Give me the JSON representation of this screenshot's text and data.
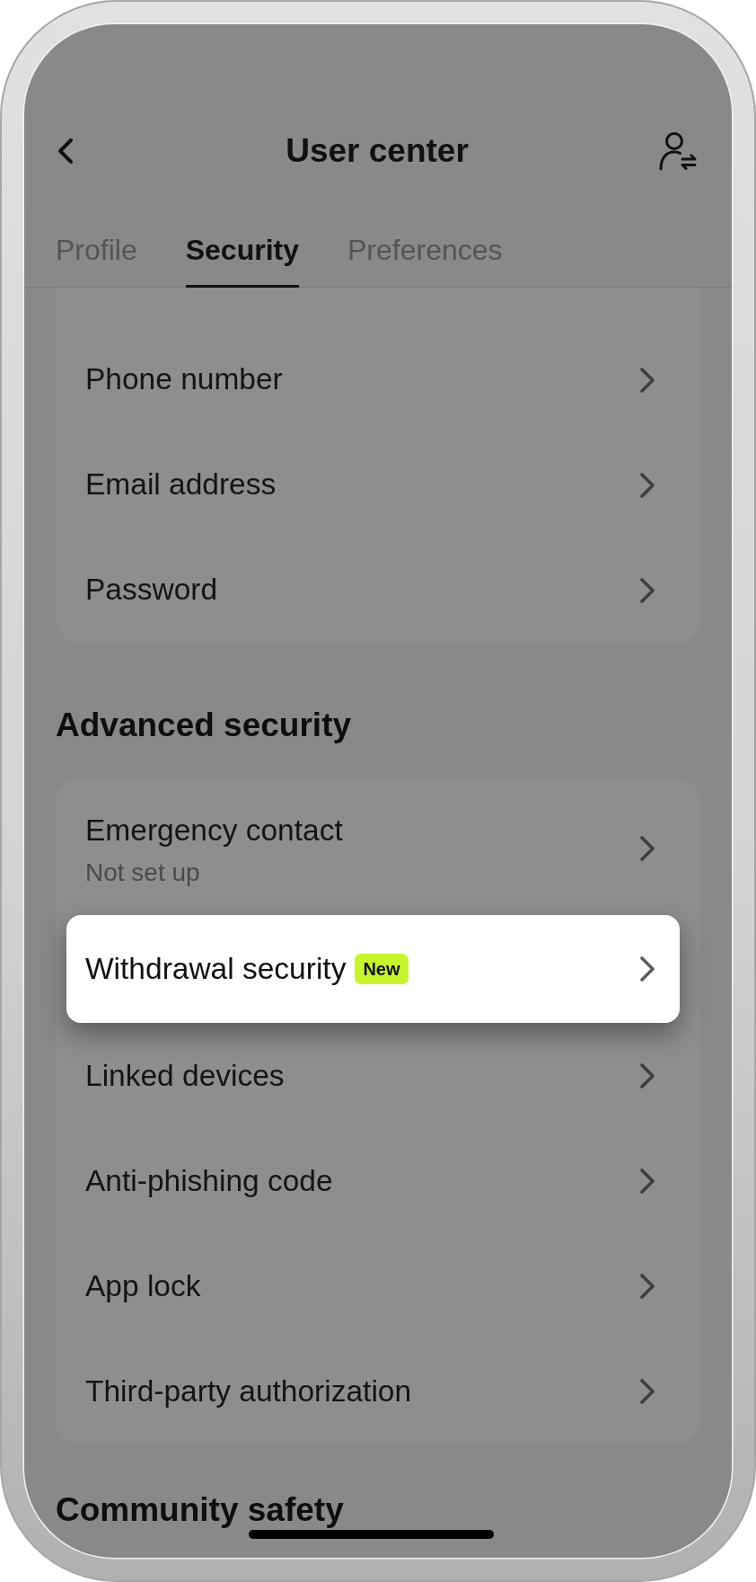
{
  "header": {
    "title": "User center"
  },
  "tabs": [
    {
      "label": "Profile",
      "selected": false
    },
    {
      "label": "Security",
      "selected": true
    },
    {
      "label": "Preferences",
      "selected": false
    }
  ],
  "sections": [
    {
      "items": [
        {
          "label": "Phone number",
          "highlighted": false
        },
        {
          "label": "Email address",
          "highlighted": false
        },
        {
          "label": "Password",
          "highlighted": false
        }
      ]
    },
    {
      "heading": "Advanced security",
      "items": [
        {
          "label": "Emergency contact",
          "status": "Not set up",
          "highlighted": false
        },
        {
          "label": "Withdrawal security",
          "badge": "New",
          "highlighted": true
        },
        {
          "label": "Linked devices",
          "highlighted": false
        },
        {
          "label": "Anti-phishing code",
          "highlighted": false
        },
        {
          "label": "App lock",
          "highlighted": false
        },
        {
          "label": "Third-party authorization",
          "highlighted": false
        }
      ]
    },
    {
      "heading": "Community safety"
    }
  ]
}
